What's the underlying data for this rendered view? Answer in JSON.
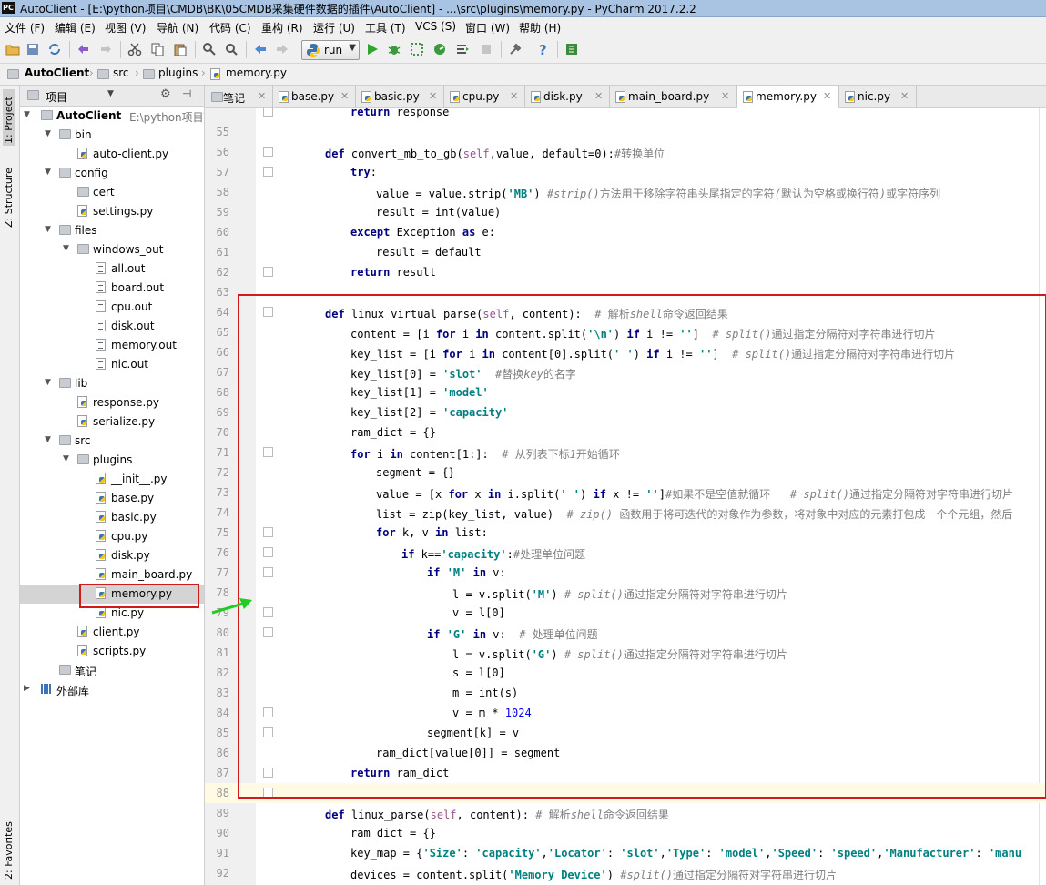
{
  "window": {
    "title": "AutoClient - [E:\\python项目\\CMDB\\BK\\05CMDB采集硬件数据的插件\\AutoClient] - ...\\src\\plugins\\memory.py - PyCharm 2017.2.2",
    "app_icon": "PC"
  },
  "menu": [
    "文件 (F)",
    "编辑 (E)",
    "视图 (V)",
    "导航 (N)",
    "代码 (C)",
    "重构 (R)",
    "运行 (U)",
    "工具 (T)",
    "VCS (S)",
    "窗口 (W)",
    "帮助 (H)"
  ],
  "toolbar": {
    "run_config": "run"
  },
  "breadcrumb": [
    "AutoClient",
    "src",
    "plugins",
    "memory.py"
  ],
  "left_strip": [
    "1: Project",
    "Z: Structure",
    "2: Favorites"
  ],
  "project_panel": {
    "header": "项目",
    "tree": [
      {
        "label": "AutoClient",
        "extra": "E:\\python项目\\C",
        "kind": "root"
      },
      {
        "label": "bin",
        "kind": "folder"
      },
      {
        "label": "auto-client.py",
        "kind": "py"
      },
      {
        "label": "config",
        "kind": "folder"
      },
      {
        "label": "cert",
        "kind": "folder"
      },
      {
        "label": "settings.py",
        "kind": "py"
      },
      {
        "label": "files",
        "kind": "folder"
      },
      {
        "label": "windows_out",
        "kind": "folder"
      },
      {
        "label": "all.out",
        "kind": "out"
      },
      {
        "label": "board.out",
        "kind": "out"
      },
      {
        "label": "cpu.out",
        "kind": "out"
      },
      {
        "label": "disk.out",
        "kind": "out"
      },
      {
        "label": "memory.out",
        "kind": "out"
      },
      {
        "label": "nic.out",
        "kind": "out"
      },
      {
        "label": "lib",
        "kind": "folder"
      },
      {
        "label": "response.py",
        "kind": "py"
      },
      {
        "label": "serialize.py",
        "kind": "py"
      },
      {
        "label": "src",
        "kind": "folder"
      },
      {
        "label": "plugins",
        "kind": "folder"
      },
      {
        "label": "__init__.py",
        "kind": "py"
      },
      {
        "label": "base.py",
        "kind": "py"
      },
      {
        "label": "basic.py",
        "kind": "py"
      },
      {
        "label": "cpu.py",
        "kind": "py"
      },
      {
        "label": "disk.py",
        "kind": "py"
      },
      {
        "label": "main_board.py",
        "kind": "py"
      },
      {
        "label": "memory.py",
        "kind": "py"
      },
      {
        "label": "nic.py",
        "kind": "py"
      },
      {
        "label": "client.py",
        "kind": "py"
      },
      {
        "label": "scripts.py",
        "kind": "py"
      },
      {
        "label": "笔记",
        "kind": "folder"
      },
      {
        "label": "外部库",
        "kind": "lib"
      }
    ]
  },
  "tabs": [
    "笔记",
    "base.py",
    "basic.py",
    "cpu.py",
    "disk.py",
    "main_board.py",
    "memory.py",
    "nic.py"
  ],
  "active_tab": "memory.py",
  "code_lines": [
    {
      "n": "",
      "text": "return response"
    },
    {
      "n": "55",
      "text": ""
    },
    {
      "n": "56",
      "text": "def convert_mb_to_gb(self,value, default=0):#转换单位"
    },
    {
      "n": "57",
      "text": "try:"
    },
    {
      "n": "58",
      "text": "value = value.strip('MB') #strip()方法用于移除字符串头尾指定的字符(默认为空格或换行符)或字符序列"
    },
    {
      "n": "59",
      "text": "result = int(value)"
    },
    {
      "n": "60",
      "text": "except Exception as e:"
    },
    {
      "n": "61",
      "text": "result = default"
    },
    {
      "n": "62",
      "text": "return result"
    },
    {
      "n": "63",
      "text": ""
    },
    {
      "n": "64",
      "text": "def linux_virtual_parse(self, content):  # 解析shell命令返回结果"
    },
    {
      "n": "65",
      "text": "content = [i for i in content.split('\\n') if i != '']  # split()通过指定分隔符对字符串进行切片"
    },
    {
      "n": "66",
      "text": "key_list = [i for i in content[0].split(' ') if i != '']  # split()通过指定分隔符对字符串进行切片"
    },
    {
      "n": "67",
      "text": "key_list[0] = 'slot'  #替换key的名字"
    },
    {
      "n": "68",
      "text": "key_list[1] = 'model'"
    },
    {
      "n": "69",
      "text": "key_list[2] = 'capacity'"
    },
    {
      "n": "70",
      "text": "ram_dict = {}"
    },
    {
      "n": "71",
      "text": "for i in content[1:]:  # 从列表下标1开始循环"
    },
    {
      "n": "72",
      "text": "segment = {}"
    },
    {
      "n": "73",
      "text": "value = [x for x in i.split(' ') if x != '']#如果不是空值就循环   # split()通过指定分隔符对字符串进行切片"
    },
    {
      "n": "74",
      "text": "list = zip(key_list, value)  # zip() 函数用于将可迭代的对象作为参数，将对象中对应的元素打包成一个个元组，然后"
    },
    {
      "n": "75",
      "text": "for k, v in list:"
    },
    {
      "n": "76",
      "text": "if k=='capacity':#处理单位问题"
    },
    {
      "n": "77",
      "text": "if 'M' in v:"
    },
    {
      "n": "78",
      "text": "l = v.split('M') # split()通过指定分隔符对字符串进行切片"
    },
    {
      "n": "79",
      "text": "v = l[0]"
    },
    {
      "n": "80",
      "text": "if 'G' in v:  # 处理单位问题"
    },
    {
      "n": "81",
      "text": "l = v.split('G') # split()通过指定分隔符对字符串进行切片"
    },
    {
      "n": "82",
      "text": "s = l[0]"
    },
    {
      "n": "83",
      "text": "m = int(s)"
    },
    {
      "n": "84",
      "text": "v = m * 1024"
    },
    {
      "n": "85",
      "text": "segment[k] = v"
    },
    {
      "n": "86",
      "text": "ram_dict[value[0]] = segment"
    },
    {
      "n": "87",
      "text": "return ram_dict"
    },
    {
      "n": "88",
      "text": ""
    },
    {
      "n": "89",
      "text": "def linux_parse(self, content): # 解析shell命令返回结果"
    },
    {
      "n": "90",
      "text": "ram_dict = {}"
    },
    {
      "n": "91",
      "text": "key_map = {'Size': 'capacity','Locator': 'slot','Type': 'model','Speed': 'speed','Manufacturer': 'manu"
    },
    {
      "n": "92",
      "text": "devices = content.split('Memory Device') #split()通过指定分隔符对字符串进行切片"
    }
  ],
  "colors": {
    "keyword": "#000080",
    "string": "#008080",
    "comment": "#808080",
    "number": "#0000ff",
    "self": "#94558d",
    "highlight_border": "#d11b1b",
    "arrow": "#22cc22",
    "current_line": "#fffae3"
  }
}
